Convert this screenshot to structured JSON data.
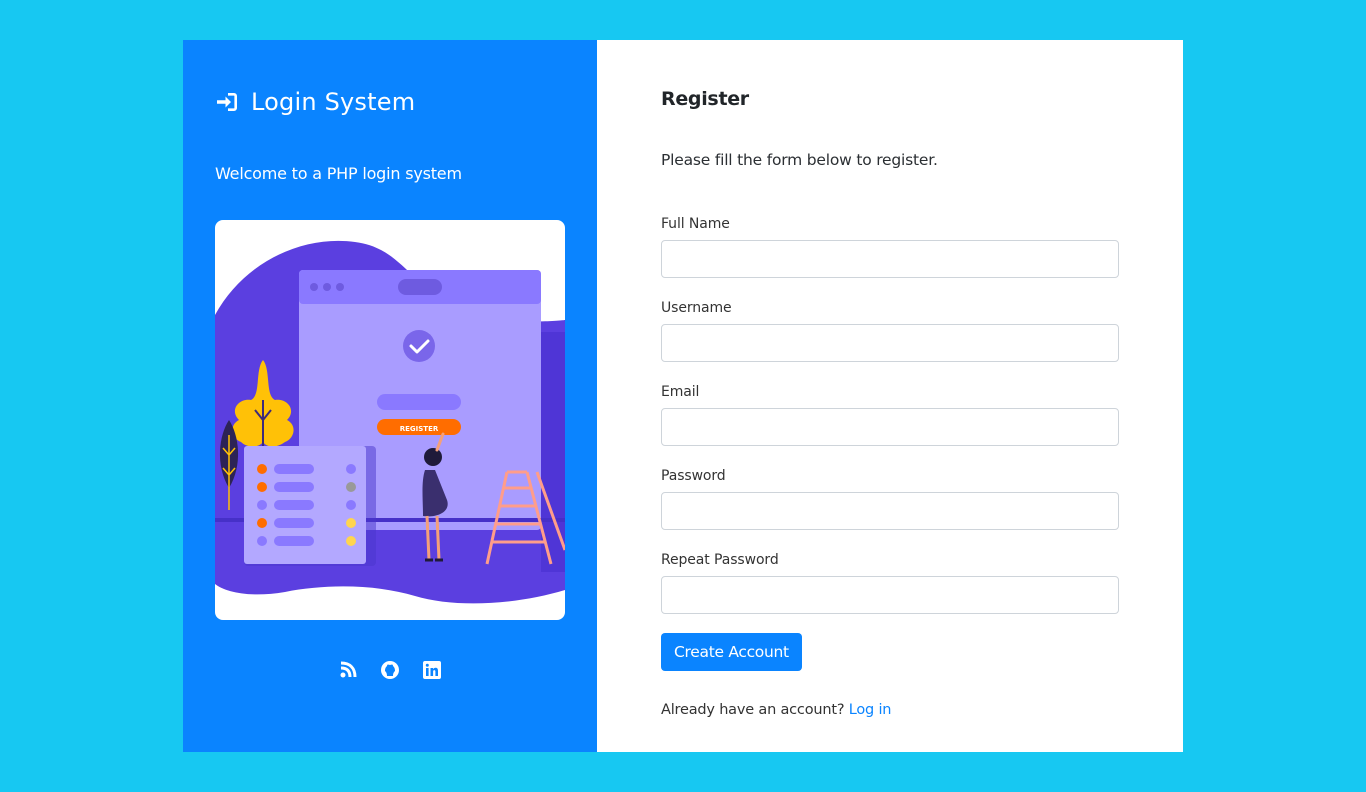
{
  "brand": {
    "icon": "sign-in-icon",
    "title": "Login System",
    "welcome": "Welcome to a PHP login system"
  },
  "illustration": {
    "button_text": "REGISTER"
  },
  "socials": [
    {
      "name": "blog-icon"
    },
    {
      "name": "github-icon"
    },
    {
      "name": "linkedin-icon"
    }
  ],
  "form": {
    "title": "Register",
    "subtitle": "Please fill the form below to register.",
    "fields": [
      {
        "label": "Full Name",
        "value": "",
        "placeholder": ""
      },
      {
        "label": "Username",
        "value": "",
        "placeholder": ""
      },
      {
        "label": "Email",
        "value": "",
        "placeholder": ""
      },
      {
        "label": "Password",
        "value": "",
        "placeholder": ""
      },
      {
        "label": "Repeat Password",
        "value": "",
        "placeholder": ""
      }
    ],
    "submit_label": "Create Account",
    "login_prompt": "Already have an account?",
    "login_link": "Log in"
  },
  "colors": {
    "page_background": "#17c8f2",
    "panel_blue": "#0a84ff",
    "illustration_purple": "#6c5ce7",
    "illustration_orange": "#ff6d00"
  }
}
